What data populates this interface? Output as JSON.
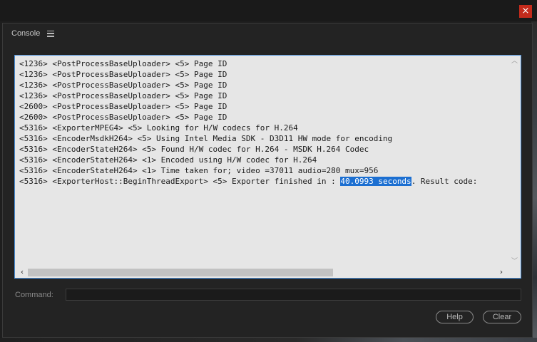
{
  "window": {
    "close_glyph": "×"
  },
  "panel": {
    "title": "Console",
    "menu_icon": "hamburger-menu-icon"
  },
  "console": {
    "lines": [
      {
        "text": "<1236> <PostProcessBaseUploader> <5> Page ID"
      },
      {
        "text": "<1236> <PostProcessBaseUploader> <5> Page ID"
      },
      {
        "text": "<1236> <PostProcessBaseUploader> <5> Page ID"
      },
      {
        "text": "<1236> <PostProcessBaseUploader> <5> Page ID"
      },
      {
        "text": "<2600> <PostProcessBaseUploader> <5> Page ID"
      },
      {
        "text": "<2600> <PostProcessBaseUploader> <5> Page ID"
      },
      {
        "text": "<5316> <ExporterMPEG4> <5> Looking for H/W codecs for H.264"
      },
      {
        "text": "<5316> <EncoderMsdkH264> <5> Using Intel Media SDK - D3D11 HW mode for encoding"
      },
      {
        "text": "<5316> <EncoderStateH264> <5> Found H/W codec for H.264 - MSDK H.264 Codec"
      },
      {
        "text": "<5316> <EncoderStateH264> <1> Encoded using H/W codec for H.264"
      },
      {
        "text": "<5316> <EncoderStateH264> <1> Time taken for; video =37011 audio=280 mux=956"
      },
      {
        "prefix": "<5316> <ExporterHost::BeginThreadExport> <5> Exporter finished in : ",
        "highlight": "40.0993 seconds",
        "suffix": ". Result code:"
      }
    ],
    "highlight_color": "#1c6fd1"
  },
  "command": {
    "label": "Command:",
    "value": ""
  },
  "buttons": {
    "help": "Help",
    "clear": "Clear"
  }
}
